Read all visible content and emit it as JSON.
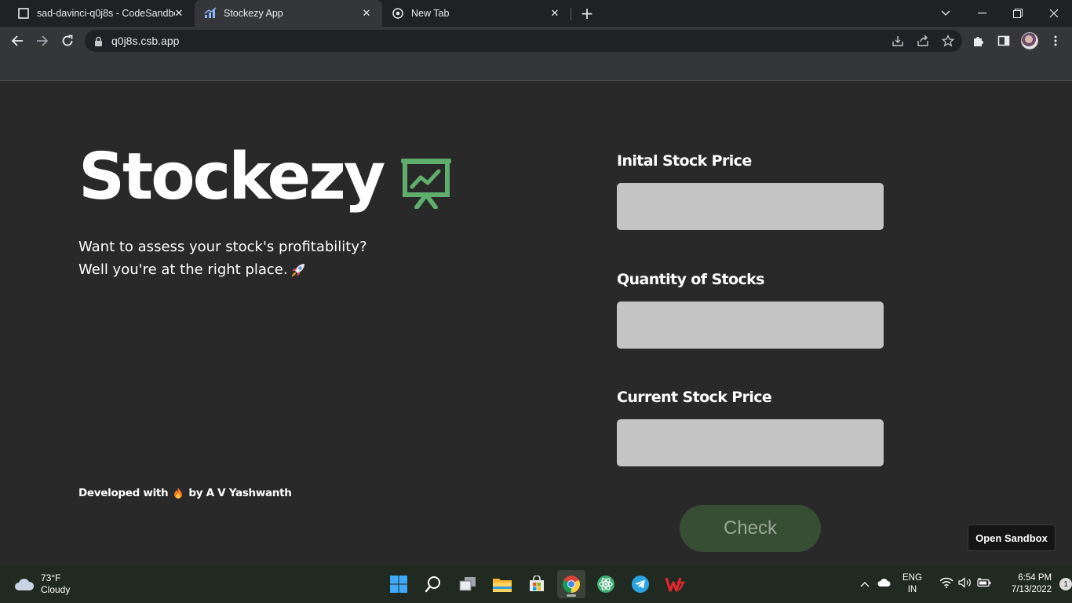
{
  "browser": {
    "tabs": [
      {
        "title": "sad-davinci-q0j8s - CodeSandbox",
        "active": false
      },
      {
        "title": "Stockezy App",
        "active": true
      },
      {
        "title": "New Tab",
        "active": false
      }
    ],
    "url": "q0j8s.csb.app"
  },
  "app": {
    "logo_text": "Stockezy",
    "tagline_line1": "Want to assess your stock's profitability?",
    "tagline_line2": "Well you're at the right place.",
    "credit_prefix": "Developed with",
    "credit_suffix": "by A V Yashwanth",
    "fields": {
      "initial_label": "Inital Stock Price",
      "initial_value": "",
      "quantity_label": "Quantity of Stocks",
      "quantity_value": "",
      "current_label": "Current Stock Price",
      "current_value": ""
    },
    "check_label": "Check",
    "open_sandbox_label": "Open Sandbox",
    "colors": {
      "accent": "#5fae6e",
      "background": "#292929",
      "input_bg": "#c4c4c4",
      "button_bg": "#374e35"
    }
  },
  "taskbar": {
    "weather_temp": "73°F",
    "weather_desc": "Cloudy",
    "lang_line1": "ENG",
    "lang_line2": "IN",
    "time": "6:54 PM",
    "date": "7/13/2022",
    "notification_count": "1"
  }
}
